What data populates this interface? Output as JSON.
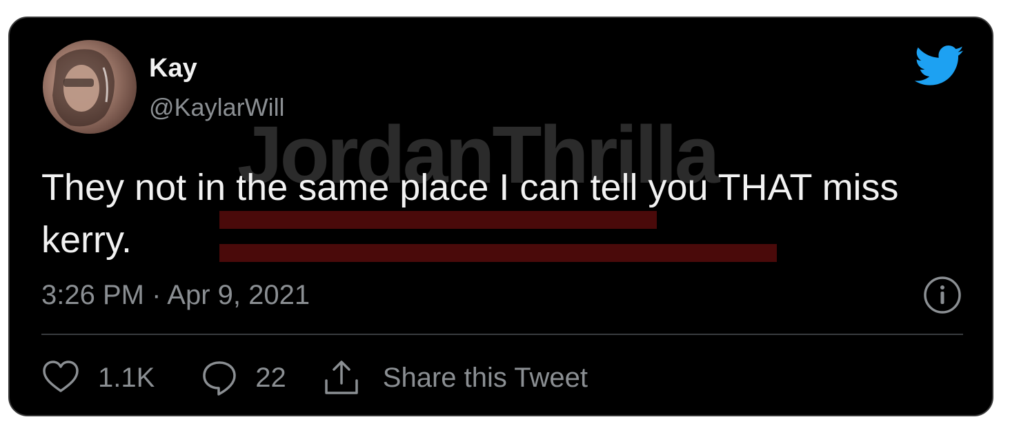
{
  "tweet": {
    "author_name": "Kay",
    "author_handle": "@KaylarWill",
    "text": "They not in the same place I can tell you THAT miss kerry.",
    "timestamp": "3:26 PM · Apr 9, 2021",
    "likes": "1.1K",
    "replies": "22",
    "share_label": "Share this Tweet"
  },
  "watermark": {
    "text": "JordanThrilla"
  },
  "icons": {
    "logo": "twitter-bird-icon",
    "info": "info-icon",
    "like": "heart-icon",
    "reply": "speech-bubble-icon",
    "share": "share-upload-icon"
  },
  "colors": {
    "card_bg": "#000000",
    "primary_text": "#f2f2f2",
    "secondary_text": "#8b8f93",
    "twitter_blue": "#1da1f2",
    "watermark_bar": "#4a0a0a"
  }
}
